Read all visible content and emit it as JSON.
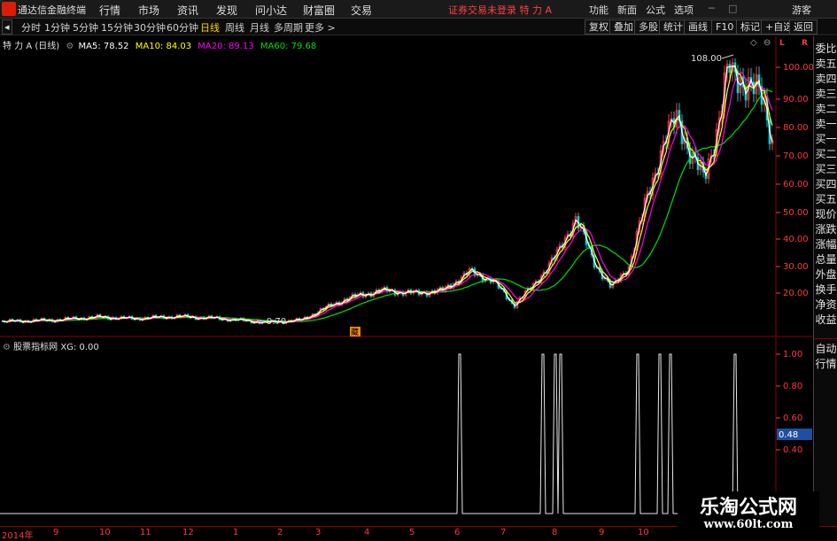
{
  "app": {
    "title": "通达信金融终端"
  },
  "menu": [
    "行情",
    "市场",
    "资讯",
    "发现",
    "问小达",
    "财富圈",
    "交易"
  ],
  "login_warning": "证券交易未登录  特 力 A",
  "right_menu": [
    "功能",
    "新面",
    "公式",
    "选项",
    "游客"
  ],
  "periods": [
    "分时",
    "1分钟",
    "5分钟",
    "15分钟",
    "30分钟",
    "60分钟",
    "日线",
    "周线",
    "月线",
    "多周期",
    "更多 >"
  ],
  "active_period": "日线",
  "tools": [
    "复权",
    "叠加",
    "多股",
    "统计",
    "画线",
    "F10",
    "标记",
    "+自选",
    "返回"
  ],
  "main_legend": {
    "stock": "特 力 A (日线)",
    "ma5": "MA5: 78.52",
    "ma10": "MA10: 84.03",
    "ma20": "MA20: 89.13",
    "ma60": "MA60: 79.68"
  },
  "colors": {
    "ma5": "#ffffff",
    "ma10": "#ffff00",
    "ma20": "#ff00ff",
    "ma60": "#00e000",
    "up": "#ff3b3b",
    "down": "#00d0d0",
    "axis": "#ff3b3b"
  },
  "annotations": {
    "high": "108.00",
    "low": "9.70",
    "badge": "藏"
  },
  "price_axis": [
    "100.00",
    "90.00",
    "80.00",
    "70.00",
    "60.00",
    "50.00",
    "40.00",
    "30.00",
    "20.00"
  ],
  "indicator_legend": "股票指标网  XG: 0.00",
  "indicator_axis": [
    "1.00",
    "0.80",
    "0.60",
    "0.40"
  ],
  "indicator_current": "0.48",
  "sidebar_top": [
    "委比",
    "卖五",
    "卖四",
    "卖三",
    "卖二",
    "卖一",
    "买一",
    "买二",
    "买三",
    "买四",
    "买五",
    "现价",
    "涨跌",
    "涨幅",
    "总量",
    "外盘",
    "换手",
    "净资",
    "收益"
  ],
  "sidebar_bottom": [
    "自动",
    "行情"
  ],
  "time_axis": [
    "2014年",
    "9",
    "10",
    "11",
    "12",
    "1",
    "2",
    "3",
    "4",
    "5",
    "6",
    "7",
    "8",
    "9",
    "10"
  ],
  "watermark": {
    "title": "乐淘公式网",
    "url": "www.60lt.com"
  }
}
